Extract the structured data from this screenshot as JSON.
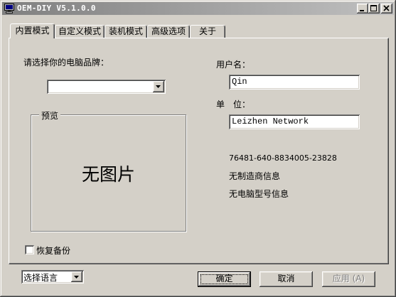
{
  "window": {
    "title": "OEM-DIY V5.1.0.0"
  },
  "icons": {
    "app": "monitor-icon",
    "minimize": "minimize-icon",
    "maximize": "maximize-icon",
    "close": "close-icon",
    "dropdown": "chevron-down-icon",
    "checkbox": "checkbox-icon"
  },
  "theme": {
    "face": "#d4d0c8",
    "title_start": "#808080",
    "title_end": "#c0c0c0"
  },
  "tabs": [
    {
      "label": "内置模式",
      "active": true
    },
    {
      "label": "自定义模式",
      "active": false
    },
    {
      "label": "装机模式",
      "active": false
    },
    {
      "label": "高级选项",
      "active": false
    },
    {
      "label": "关于",
      "active": false
    }
  ],
  "builtin": {
    "brand_label": "请选择你的电脑品牌：",
    "brand_select_value": "",
    "preview_legend": "预览",
    "preview_placeholder": "无图片",
    "username_label": "用户名：",
    "username_value": "Qin",
    "company_label": "单　位：",
    "company_value": "Leizhen Network",
    "product_id": "76481-640-8834005-23828",
    "manufacturer_info": "无制造商信息",
    "model_info": "无电脑型号信息",
    "restore_backup_label": "恢复备份",
    "restore_backup_checked": false
  },
  "footer": {
    "language_select_value": "选择语言",
    "ok_label": "确定",
    "cancel_label": "取消",
    "apply_label": "应用 (A)"
  }
}
